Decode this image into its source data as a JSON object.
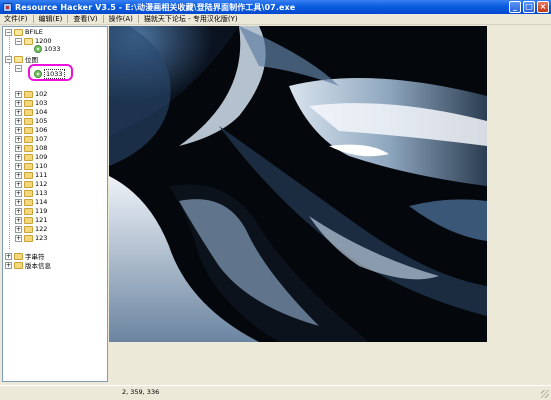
{
  "window": {
    "title": "Resource Hacker V3.5  -  E:\\动漫画相关收藏\\登陆界面制作工具\\07.exe",
    "min_label": "_",
    "max_label": "□",
    "close_label": "×"
  },
  "menu": [
    "文件(F)",
    "编辑(E)",
    "查看(V)",
    "操作(A)",
    "猫就天下论坛 - 专用汉化版(Y)"
  ],
  "tree": {
    "root1": {
      "label": "BFILE",
      "child_folder": "1200",
      "child_item": "1033"
    },
    "root2": {
      "label": "位图"
    },
    "selected": {
      "label": "1033"
    },
    "folders": [
      "102",
      "103",
      "104",
      "105",
      "106",
      "107",
      "108",
      "109",
      "110",
      "111",
      "112",
      "113",
      "114",
      "119",
      "121",
      "122",
      "123"
    ],
    "bottom": [
      "字串符",
      "版本信息"
    ]
  },
  "status": {
    "text": "2, 359, 336"
  },
  "colors": {
    "highlight": "#ee11dd",
    "title_bar": "#0a5ddf"
  }
}
